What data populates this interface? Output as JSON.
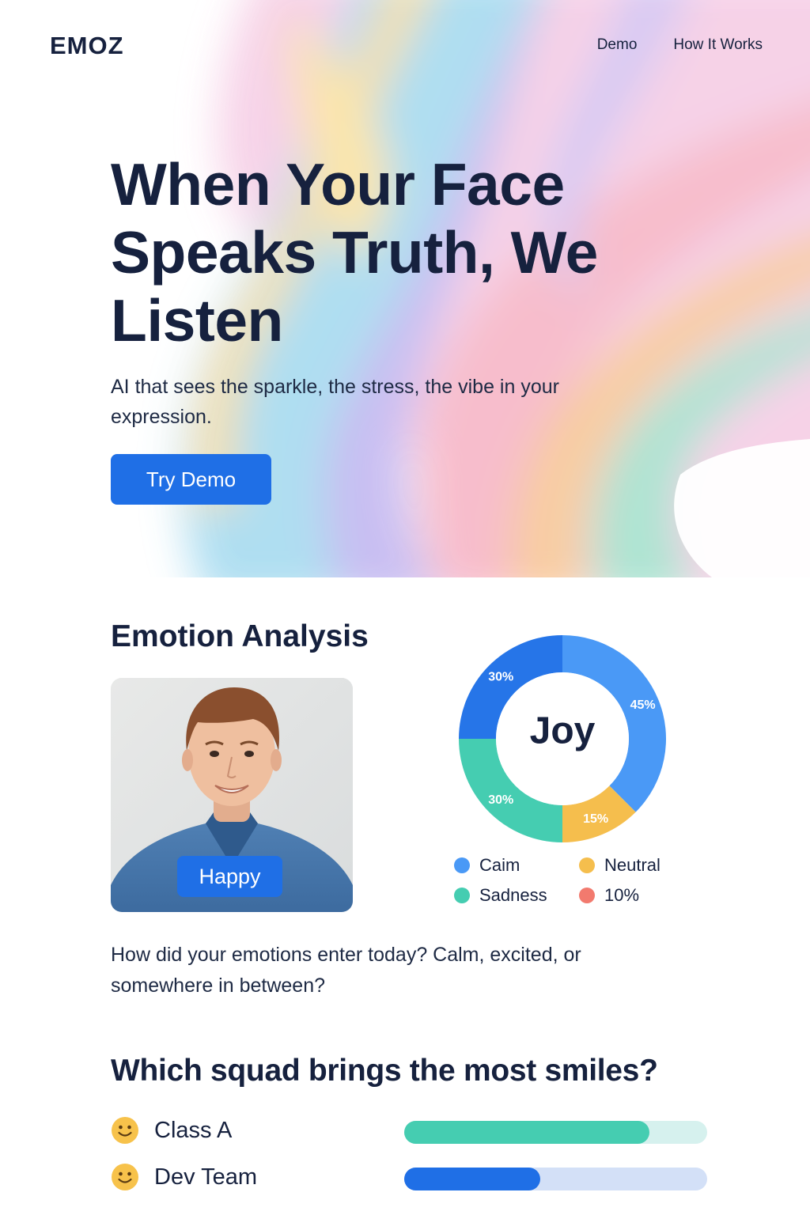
{
  "header": {
    "brand": "EMOZ",
    "nav": [
      {
        "label": "Demo"
      },
      {
        "label": "How It Works"
      }
    ]
  },
  "hero": {
    "title": "When Your Face Speaks Truth, We Listen",
    "subtitle": "AI that sees the sparkle, the stress, the vibe in your expression.",
    "cta_label": "Try Demo"
  },
  "analysis": {
    "title": "Emotion Analysis",
    "photo_label": "Happy",
    "prompt": "How did your emotions enter today? Calm, excited, or somewhere in between?"
  },
  "chart_data": {
    "type": "pie",
    "center_label": "Joy",
    "slices": [
      {
        "label": "45%",
        "value": 45,
        "color": "#4a99f6"
      },
      {
        "label": "15%",
        "value": 15,
        "color": "#f5be4d"
      },
      {
        "label": "30%",
        "value": 30,
        "color": "#45cdb1"
      },
      {
        "label": "30%",
        "value": 30,
        "color": "#2675e8"
      }
    ],
    "legend": [
      {
        "label": "Caim",
        "color": "#4a99f6"
      },
      {
        "label": "Neutral",
        "color": "#f5be4d"
      },
      {
        "label": "Sadness",
        "color": "#45cdb1"
      },
      {
        "label": "10%",
        "color": "#f27a6e"
      }
    ]
  },
  "squads": {
    "title": "Which squad brings the most smiles?",
    "items": [
      {
        "name": "Class A",
        "value": 0.81,
        "color": "#45cdb1",
        "track_color": "#d6f1ee"
      },
      {
        "name": "Dev Team",
        "value": 0.45,
        "color": "#1f6fe6",
        "track_color": "#d3e0f7"
      }
    ]
  }
}
